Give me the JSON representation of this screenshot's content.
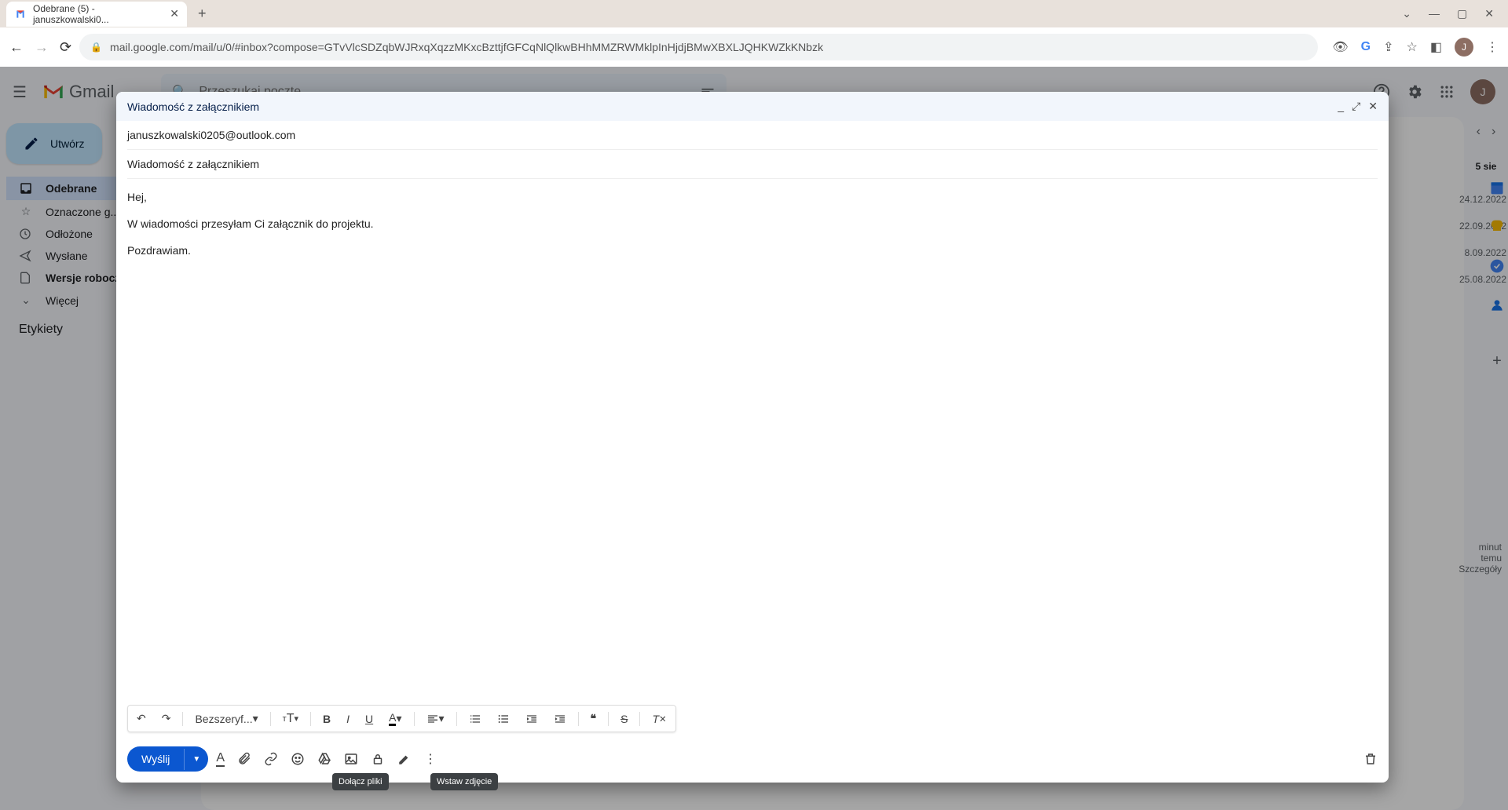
{
  "browser": {
    "tab_title": "Odebrane (5) - januszkowalski0...",
    "url": "mail.google.com/mail/u/0/#inbox?compose=GTvVlcSDZqbWJRxqXqzzMKxcBzttjfGFCqNlQlkwBHhMMZRWMklpInHjdjBMwXBXLJQHKWZkKNbzk",
    "avatar_initial": "J"
  },
  "gmail": {
    "logo_text": "Gmail",
    "search_placeholder": "Przeszukaj pocztę",
    "compose_label": "Utwórz",
    "nav": {
      "inbox": "Odebrane",
      "starred": "Oznaczone g...",
      "snoozed": "Odłożone",
      "sent": "Wysłane",
      "drafts": "Wersje robocz...",
      "more": "Więcej"
    },
    "labels_title": "Etykiety",
    "date_header": "5 sie",
    "list_dates": [
      "24.12.2022",
      "22.09.2022",
      "8.09.2022",
      "25.08.2022"
    ],
    "activity_time": "minut temu",
    "details": "Szczegóły"
  },
  "compose": {
    "title": "Wiadomość z załącznikiem",
    "to": "januszkowalski0205@outlook.com",
    "subject": "Wiadomość z załącznikiem",
    "body": {
      "line1": "Hej,",
      "line2": "W wiadomości przesyłam Ci załącznik do projektu.",
      "line3": "Pozdrawiam."
    },
    "font_label": "Bezszeryf...",
    "send_label": "Wyślij",
    "tooltip_attach": "Dołącz pliki",
    "tooltip_image": "Wstaw zdjęcie"
  }
}
